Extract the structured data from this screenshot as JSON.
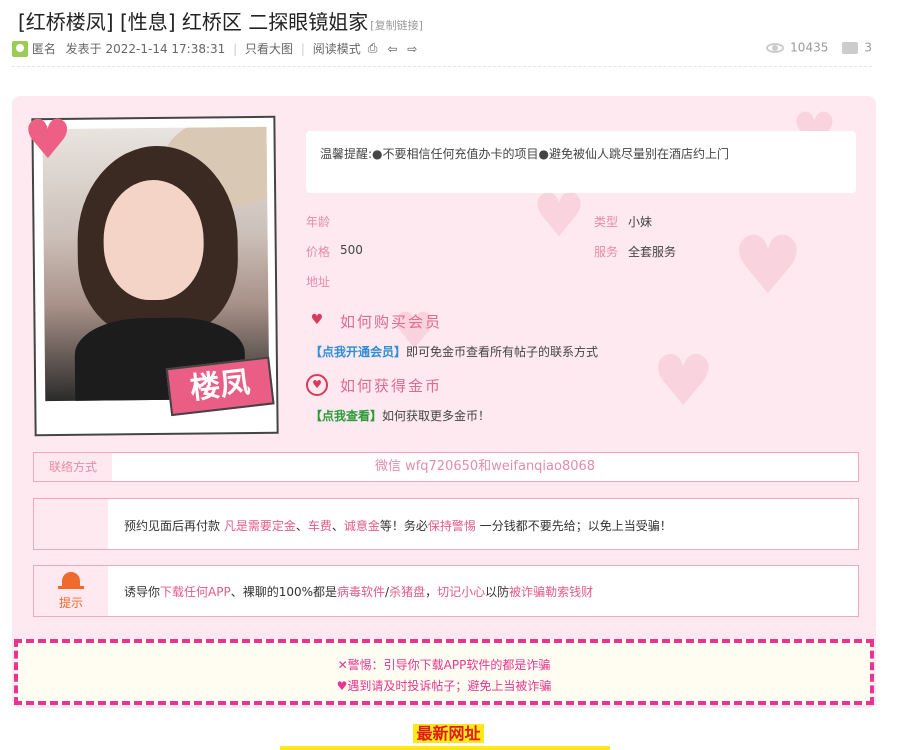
{
  "post": {
    "title": "[红桥楼凤] [性息] 红桥区 二探眼镜姐家",
    "copy_link": "[复制链接]",
    "author": "匿名",
    "posted": "发表于 2022-1-14 17:38:31",
    "view_image": "只看大图",
    "read_mode": "阅读模式",
    "views": "10435",
    "replies": "3"
  },
  "profile": {
    "name_tag": "楼凤",
    "notice": "温馨提醒:●不要相信任何充值办卡的项目●避免被仙人跳尽量别在酒店约上门",
    "fields": {
      "age_label": "年龄",
      "age_value": "",
      "type_label": "类型",
      "type_value": "小妹",
      "price_label": "价格",
      "price_value": "500",
      "service_label": "服务",
      "service_value": "全套服务",
      "address_label": "地址",
      "address_value": ""
    },
    "buy_title": "如何购买会员",
    "buy_link": "【点我开通会员】",
    "buy_text": "即可免金币查看所有帖子的联系方式",
    "coin_title": "如何获得金币",
    "coin_link": "【点我查看】",
    "coin_text": "如何获取更多金币！"
  },
  "contact": {
    "label": "联络方式",
    "value": "微信 wfq720650和weifanqiao8068"
  },
  "warning1": {
    "t1": "预约见面后再付款 ",
    "h1": "凡是需要定金",
    "t2": "、",
    "h2": "车费",
    "t3": "、",
    "h3": "诚意金",
    "t4": "等！务必",
    "h4": "保持警惕",
    "t5": " 一分钱都不要先给；以免上当受骗！"
  },
  "warning2": {
    "side_label": "提示",
    "t1": "诱导你",
    "h1": "下载任何APP",
    "t2": "、裸聊的100%都是",
    "h2": "病毒软件",
    "t3": "/",
    "h3": "杀猪盘",
    "t4": "，",
    "h4": "切记小心",
    "t5": "以防",
    "h5": "被诈骗勒索钱财"
  },
  "alert": {
    "line1": "✕警惕：引导你下载APP软件的都是诈骗",
    "line2": "♥遇到请及时投诉帖子；避免上当被诈骗"
  },
  "footer": {
    "newest": "最新网址"
  },
  "colors": {
    "pink_bg": "#fde9ef",
    "pink_text": "#e58ca8",
    "accent": "#e9358f",
    "alert_bg": "#fffdf2"
  }
}
